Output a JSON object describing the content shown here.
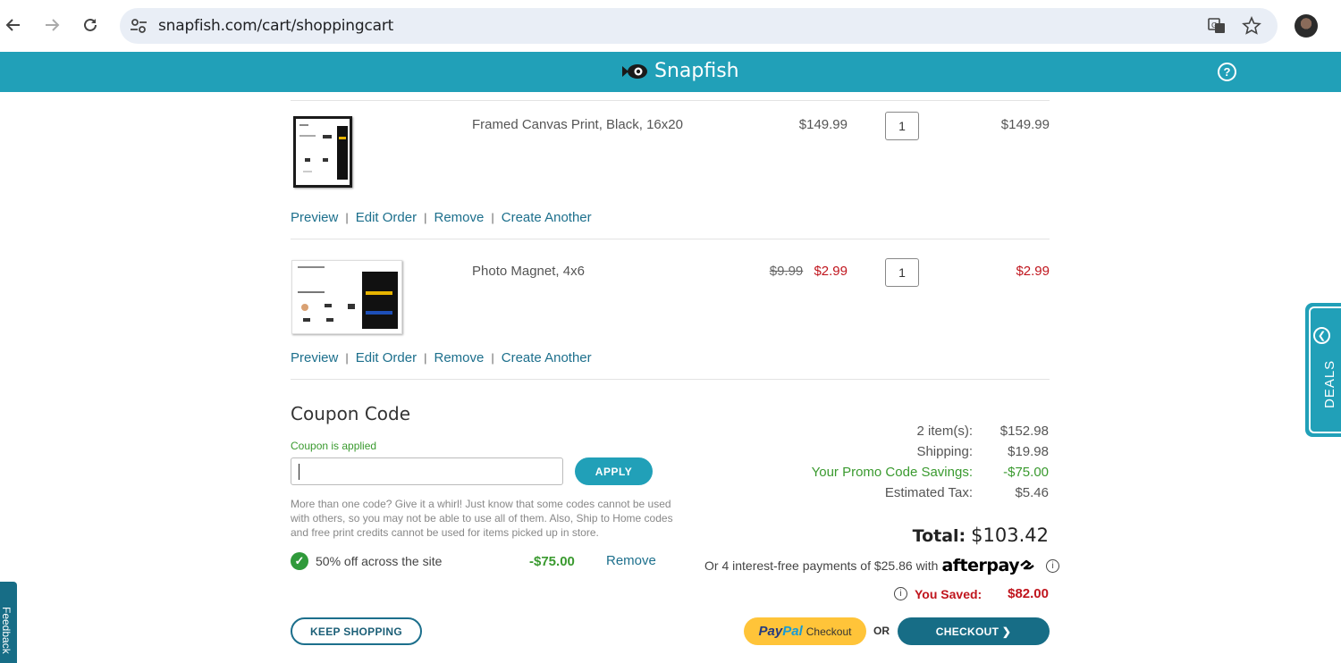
{
  "browser": {
    "url": "snapfish.com/cart/shoppingcart",
    "icons": [
      "back-icon",
      "forward-icon",
      "reload-icon",
      "site-settings-icon",
      "translate-icon",
      "bookmark-star-icon",
      "profile-avatar"
    ]
  },
  "header": {
    "brand": "Snapfish",
    "help_icon": "?",
    "bg_color": "#21a0b8"
  },
  "cart": {
    "items": [
      {
        "name": "Framed Canvas Print, Black, 16x20",
        "unit_price": "$149.99",
        "quantity": "1",
        "total": "$149.99",
        "actions": [
          "Preview",
          "Edit Order",
          "Remove",
          "Create Another"
        ]
      },
      {
        "name": "Photo Magnet, 4x6",
        "original_price": "$9.99",
        "sale_price": "$2.99",
        "quantity": "1",
        "total": "$2.99",
        "actions": [
          "Preview",
          "Edit Order",
          "Remove",
          "Create Another"
        ]
      }
    ],
    "separator": "|"
  },
  "coupon": {
    "title": "Coupon Code",
    "status": "Coupon is applied",
    "input_value": "",
    "apply_label": "APPLY",
    "note": "More than one code? Give it a whirl! Just know that some codes cannot be used with others, so you may not be able to use all of them. Also, Ship to Home codes and free print credits cannot be used for items picked up in store.",
    "applied": {
      "label": "50% off across the site",
      "amount": "-$75.00",
      "remove": "Remove"
    }
  },
  "summary": {
    "rows": [
      {
        "label": "2 item(s):",
        "value": "$152.98"
      },
      {
        "label": "Shipping:",
        "value": "$19.98"
      },
      {
        "label": "Your Promo Code Savings:",
        "value": "-$75.00"
      },
      {
        "label": "Estimated Tax:",
        "value": "$5.46"
      }
    ],
    "total_label": "Total:",
    "total_value": "$103.42",
    "afterpay_text": "Or 4 interest-free payments of $25.86 with",
    "afterpay_brand": "afterpay",
    "saved_label": "You Saved:",
    "saved_value": "$82.00"
  },
  "buttons": {
    "keep_shopping": "KEEP SHOPPING",
    "paypal_brand_a": "Pay",
    "paypal_brand_b": "Pal",
    "paypal_checkout": "Checkout",
    "or": "OR",
    "checkout": "CHECKOUT ❯"
  },
  "side_tabs": {
    "deals": "DEALS",
    "feedback": "Feedback"
  }
}
